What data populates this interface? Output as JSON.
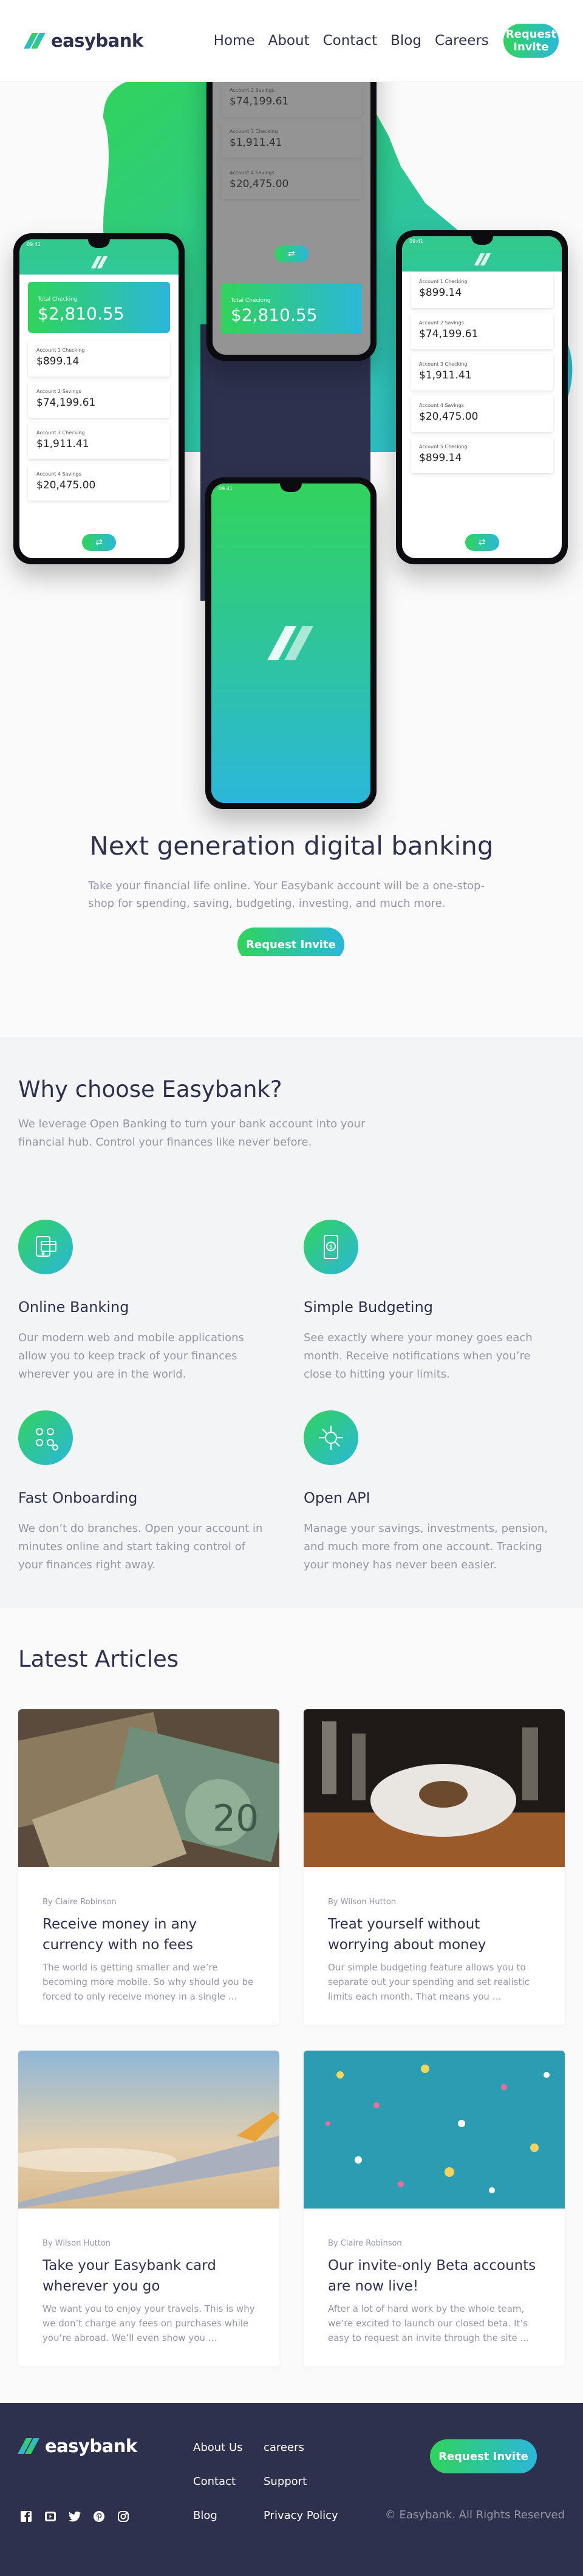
{
  "brand": {
    "name": "easybank",
    "colors": {
      "green": "#31d35c",
      "cyan": "#2bb7da",
      "navy": "#2d314d",
      "gray": "#9597a7"
    }
  },
  "nav": {
    "items": [
      "Home",
      "About",
      "Contact",
      "Blog",
      "Careers"
    ],
    "cta_label": "Request Invite"
  },
  "hero": {
    "title": "Next generation digital banking",
    "description": "Take your financial life online. Your Easybank account will be a one-stop-shop for spending, saving, budgeting, investing, and much more.",
    "cta_label": "Request Invite",
    "phone": {
      "total_label": "Total Checking",
      "total_amount": "$2,810.55",
      "accounts": [
        {
          "label": "Account 1 Checking",
          "amount": "$899.14"
        },
        {
          "label": "Account 2 Savings",
          "amount": "$74,199.61"
        },
        {
          "label": "Account 3 Checking",
          "amount": "$1,911.41"
        },
        {
          "label": "Account 4 Savings",
          "amount": "$20,475.00"
        },
        {
          "label": "Account 5 Checking",
          "amount": "$899.14"
        }
      ],
      "status_time": "09:41"
    }
  },
  "why": {
    "title": "Why choose Easybank?",
    "intro": "We leverage Open Banking to turn your bank account into your financial hub. Control your finances like never before.",
    "features": [
      {
        "icon": "online-banking-icon",
        "title": "Online Banking",
        "text": "Our modern web and mobile applications allow you to keep track of your finances wherever you are in the world."
      },
      {
        "icon": "budgeting-icon",
        "title": "Simple Budgeting",
        "text": "See exactly where your money goes each month. Receive notifications when you’re close to hitting your limits."
      },
      {
        "icon": "onboarding-icon",
        "title": "Fast Onboarding",
        "text": "We don’t do branches. Open your account in minutes online and start taking control of your finances right away."
      },
      {
        "icon": "api-icon",
        "title": "Open API",
        "text": "Manage your savings, investments, pension, and much more from one account. Tracking your money has never been easier."
      }
    ]
  },
  "articles": {
    "title": "Latest Articles",
    "items": [
      {
        "author": "By Claire Robinson",
        "title": "Receive money in any currency with no fees",
        "excerpt": "The world is getting smaller and we’re becoming more mobile. So why should you be forced to only receive money in a single …"
      },
      {
        "author": "By Wilson Hutton",
        "title": "Treat yourself without worrying about money",
        "excerpt": "Our simple budgeting feature allows you to separate out your spending and set realistic limits each month. That means you …"
      },
      {
        "author": "By Wilson Hutton",
        "title": "Take your Easybank card wherever you go",
        "excerpt": "We want you to enjoy your travels. This is why we don’t charge any fees on purchases while you’re abroad. We’ll even show you …"
      },
      {
        "author": "By Claire Robinson",
        "title": "Our invite-only Beta accounts are now live!",
        "excerpt": "After a lot of hard work by the whole team, we’re excited to launch our closed beta. It’s easy to request an invite through the site ..."
      }
    ]
  },
  "footer": {
    "links": [
      "About Us",
      "careers",
      "Contact",
      "Support",
      "Blog",
      "Privacy Policy"
    ],
    "cta_label": "Request Invite",
    "copyright": "© Easybank. All Rights Reserved",
    "socials": [
      "facebook-icon",
      "youtube-icon",
      "twitter-icon",
      "pinterest-icon",
      "instagram-icon"
    ]
  }
}
